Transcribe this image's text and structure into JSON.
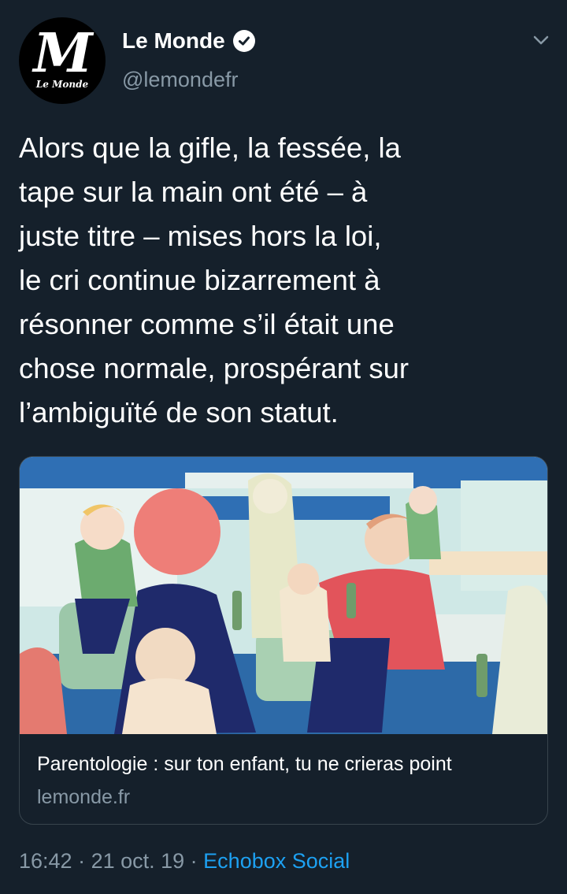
{
  "account": {
    "name": "Le Monde",
    "handle": "@lemondefr",
    "avatar_letter": "M",
    "avatar_wordmark": "Le Monde"
  },
  "tweet": {
    "lines": [
      "Alors que la gifle, la fessée, la",
      "tape sur la main ont été – à",
      "juste titre – mises hors la loi,",
      "le cri continue bizarrement à",
      "résonner comme s’il était une",
      "chose normale, prospérant sur",
      "l’ambiguïté de son statut."
    ]
  },
  "card": {
    "title": "Parentologie : sur ton enfant, tu ne crieras point",
    "domain": "lemonde.fr"
  },
  "meta": {
    "time": "16:42",
    "sep1": " · ",
    "date": "21 oct. 19",
    "sep2": " · ",
    "source": "Echobox Social"
  },
  "colors": {
    "background": "#15202b",
    "secondary_text": "#8899a6",
    "link": "#1da1f2",
    "border": "#38444d"
  },
  "icons": {
    "verified": "verified-badge-icon",
    "more": "chevron-down-icon"
  }
}
